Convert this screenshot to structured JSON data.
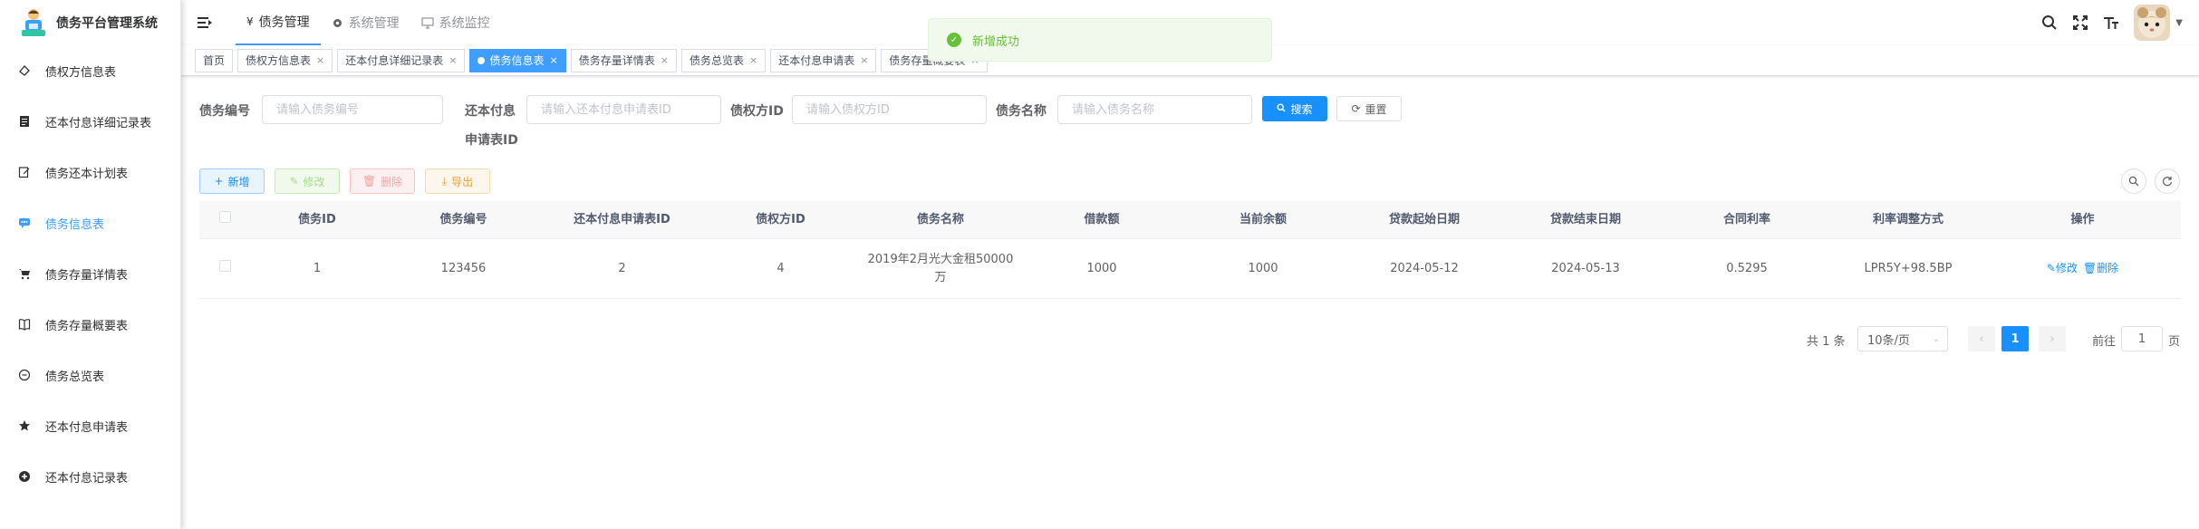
{
  "app": {
    "title": "债务平台管理系统",
    "accent": "#409eff"
  },
  "sidebar": {
    "items": [
      {
        "label": "债权方信息表",
        "icon": "form-icon",
        "active": false
      },
      {
        "label": "还本付息详细记录表",
        "icon": "document-icon",
        "active": false
      },
      {
        "label": "债务还本计划表",
        "icon": "edit-icon",
        "active": false
      },
      {
        "label": "债务信息表",
        "icon": "message-icon",
        "active": true
      },
      {
        "label": "债务存量详情表",
        "icon": "cart-icon",
        "active": false
      },
      {
        "label": "债务存量概要表",
        "icon": "book-icon",
        "active": false
      },
      {
        "label": "债务总览表",
        "icon": "minus-circle-icon",
        "active": false
      },
      {
        "label": "还本付息申请表",
        "icon": "star-icon",
        "active": false
      },
      {
        "label": "还本付息记录表",
        "icon": "plus-circle-icon",
        "active": false
      }
    ]
  },
  "topnav": {
    "items": [
      {
        "label": "债务管理",
        "icon": "yen-icon",
        "active": true
      },
      {
        "label": "系统管理",
        "icon": "gear-icon",
        "active": false
      },
      {
        "label": "系统监控",
        "icon": "monitor-icon",
        "active": false
      }
    ]
  },
  "tags": [
    {
      "label": "首页",
      "closable": false,
      "active": false
    },
    {
      "label": "债权方信息表",
      "closable": true,
      "active": false
    },
    {
      "label": "还本付息详细记录表",
      "closable": true,
      "active": false
    },
    {
      "label": "债务信息表",
      "closable": true,
      "active": true
    },
    {
      "label": "债务存量详情表",
      "closable": true,
      "active": false
    },
    {
      "label": "债务总览表",
      "closable": true,
      "active": false
    },
    {
      "label": "还本付息申请表",
      "closable": true,
      "active": false
    },
    {
      "label": "债务存量概要表",
      "closable": true,
      "active": false
    }
  ],
  "toast": {
    "message": "新增成功",
    "type": "success"
  },
  "search": {
    "debt_no_label": "债务编号",
    "debt_no_placeholder": "请输入债务编号",
    "apply_id_label_line1": "还本付息",
    "apply_id_label_line2": "申请表ID",
    "apply_id_placeholder": "请输入还本付息申请表ID",
    "creditor_label": "债权方ID",
    "creditor_placeholder": "请输入债权方ID",
    "debt_name_label": "债务名称",
    "debt_name_placeholder": "请输入债务名称",
    "search_btn": "搜索",
    "reset_btn": "重置"
  },
  "toolbar": {
    "add": "新增",
    "edit": "修改",
    "delete": "删除",
    "export": "导出"
  },
  "table": {
    "columns": [
      "债务ID",
      "债务编号",
      "还本付息申请表ID",
      "债权方ID",
      "债务名称",
      "借款额",
      "当前余额",
      "贷款起始日期",
      "贷款结束日期",
      "合同利率",
      "利率调整方式",
      "操作"
    ],
    "rows": [
      {
        "cells": [
          "1",
          "123456",
          "2",
          "4",
          "2019年2月光大金租50000万",
          "1000",
          "1000",
          "2024-05-12",
          "2024-05-13",
          "0.5295",
          "LPR5Y+98.5BP"
        ],
        "edit": "修改",
        "delete": "删除"
      }
    ]
  },
  "pagination": {
    "total_text": "共 1 条",
    "page_size": "10条/页",
    "current_page": "1",
    "goto_prefix": "前往",
    "goto_value": "1",
    "goto_suffix": "页"
  }
}
